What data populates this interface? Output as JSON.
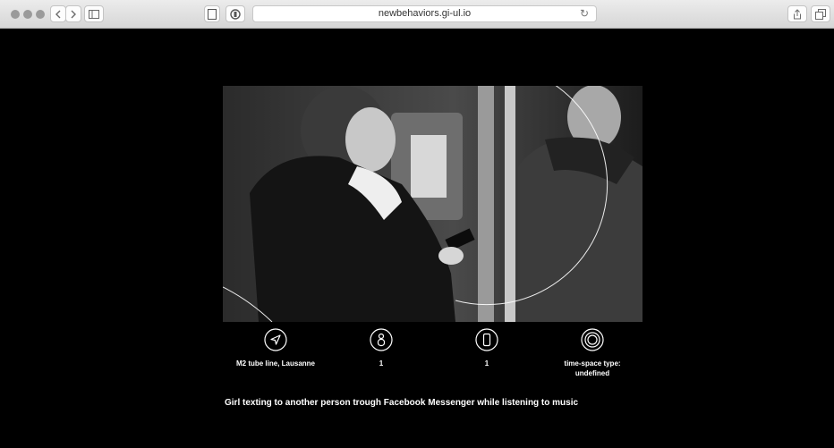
{
  "browser": {
    "url": "newbehaviors.gi-ul.io"
  },
  "meta": {
    "location": "M2 tube line, Lausanne",
    "people_count": "1",
    "devices_count": "1",
    "time_space_type": "time-space type:\nundefined"
  },
  "caption": "Girl texting to another person trough Facebook Messenger while listening to music",
  "icons": {
    "location": "navigation-arrow-icon",
    "people": "person-icon",
    "device": "smartphone-icon",
    "time_space": "concentric-circles-icon"
  },
  "colors": {
    "background": "#000000",
    "text": "#ffffff"
  }
}
